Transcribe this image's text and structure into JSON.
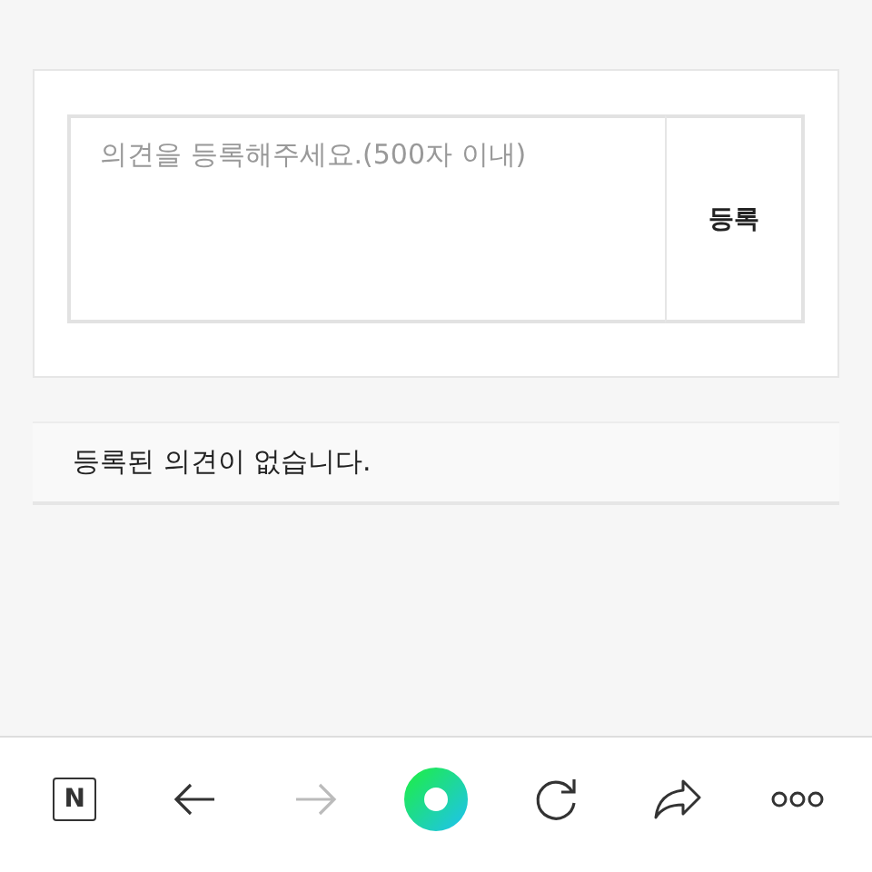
{
  "comment_form": {
    "placeholder": "의견을 등록해주세요.(500자 이내)",
    "submit": "등록"
  },
  "empty_message": "등록된 의견이 없습니다.",
  "toolbar": [
    {
      "kind": "logo",
      "label": "N",
      "disabled": false
    },
    {
      "kind": "back",
      "disabled": false
    },
    {
      "kind": "forward",
      "disabled": true
    },
    {
      "kind": "green",
      "disabled": false
    },
    {
      "kind": "reload",
      "disabled": false
    },
    {
      "kind": "share",
      "disabled": false
    },
    {
      "kind": "more",
      "disabled": false
    }
  ]
}
